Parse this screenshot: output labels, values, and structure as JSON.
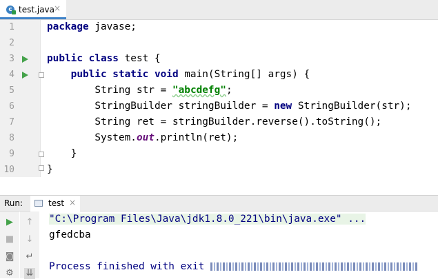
{
  "editor_tab": {
    "label": "test.java",
    "close": "×"
  },
  "editor": {
    "lines": [
      {
        "num": "1"
      },
      {
        "num": "2"
      },
      {
        "num": "3"
      },
      {
        "num": "4"
      },
      {
        "num": "5"
      },
      {
        "num": "6"
      },
      {
        "num": "7"
      },
      {
        "num": "8"
      },
      {
        "num": "9"
      },
      {
        "num": "10"
      }
    ],
    "code": {
      "l1_kw": "package",
      "l1_rest": " javase;",
      "l3_kw": "public class",
      "l3_rest": " test {",
      "l4_kw": "public static void",
      "l4_rest": " main(String[] args) {",
      "l5_pre": "String str = ",
      "l5_str": "\"abcdefg\"",
      "l5_post": ";",
      "l6_pre": "StringBuilder stringBuilder = ",
      "l6_kw": "new",
      "l6_post": " StringBuilder(str);",
      "l7": "String ret = stringBuilder.reverse().toString();",
      "l8_pre": "System.",
      "l8_fld": "out",
      "l8_post": ".println(ret);",
      "l9": "}",
      "l10": "}"
    }
  },
  "run_panel": {
    "label": "Run:",
    "tab_label": "test",
    "tab_close": "×",
    "console": {
      "command": "\"C:\\Program Files\\Java\\jdk1.8.0_221\\bin\\java.exe\" ...",
      "output": "gfedcba",
      "process": "Process finished with exit"
    }
  },
  "colors": {
    "keyword": "#000080",
    "string": "#008000",
    "run_green": "#44a24a",
    "accent": "#4083c9"
  }
}
